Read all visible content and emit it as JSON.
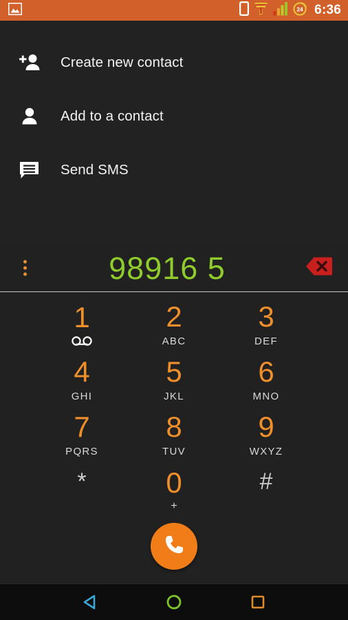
{
  "statusbar": {
    "time": "6:36",
    "icons": [
      {
        "name": "screenshot-image-icon",
        "glyph": "image"
      },
      {
        "name": "vibrate-mode-icon",
        "glyph": "phone-vibrate"
      },
      {
        "name": "wifi-signal-icon",
        "glyph": "wifi-funnel"
      },
      {
        "name": "cellular-signal-icon",
        "glyph": "signal-bars"
      },
      {
        "name": "alarm-24-icon",
        "glyph": "badge-24"
      }
    ],
    "background_color": "#d2602a",
    "text_color": "#ffffff"
  },
  "menu": {
    "items": [
      {
        "icon": "person-add-icon",
        "label": "Create new contact"
      },
      {
        "icon": "person-icon",
        "label": "Add to a contact"
      },
      {
        "icon": "message-icon",
        "label": "Send SMS"
      }
    ]
  },
  "number_display": {
    "value": "98916 5",
    "color": "#8fcc2b",
    "overflow_menu_label": "More options",
    "overflow_color": "#e8902f",
    "backspace_label": "Delete",
    "backspace_color": "#d32020"
  },
  "keypad": {
    "accent_color": "#ef8f2c",
    "symbol_color": "#cfcfcf",
    "keys": [
      {
        "digit": "1",
        "sub": "",
        "sub_kind": "voicemail",
        "type": "digit"
      },
      {
        "digit": "2",
        "sub": "ABC",
        "sub_kind": "letters",
        "type": "digit"
      },
      {
        "digit": "3",
        "sub": "DEF",
        "sub_kind": "letters",
        "type": "digit"
      },
      {
        "digit": "4",
        "sub": "GHI",
        "sub_kind": "letters",
        "type": "digit"
      },
      {
        "digit": "5",
        "sub": "JKL",
        "sub_kind": "letters",
        "type": "digit"
      },
      {
        "digit": "6",
        "sub": "MNO",
        "sub_kind": "letters",
        "type": "digit"
      },
      {
        "digit": "7",
        "sub": "PQRS",
        "sub_kind": "letters",
        "type": "digit"
      },
      {
        "digit": "8",
        "sub": "TUV",
        "sub_kind": "letters",
        "type": "digit"
      },
      {
        "digit": "9",
        "sub": "WXYZ",
        "sub_kind": "letters",
        "type": "digit"
      },
      {
        "digit": "*",
        "sub": "",
        "sub_kind": "none",
        "type": "symbol"
      },
      {
        "digit": "0",
        "sub": "+",
        "sub_kind": "plus",
        "type": "digit"
      },
      {
        "digit": "#",
        "sub": "",
        "sub_kind": "none",
        "type": "symbol"
      }
    ]
  },
  "call_button": {
    "label": "Call",
    "color": "#f07d18",
    "icon": "phone-handset-icon"
  },
  "navbar": {
    "back": {
      "name": "back-nav-button",
      "color": "#3aa7d9"
    },
    "home": {
      "name": "home-nav-button",
      "color": "#7cc42a"
    },
    "recents": {
      "name": "recents-nav-button",
      "color": "#e08a2c"
    }
  }
}
